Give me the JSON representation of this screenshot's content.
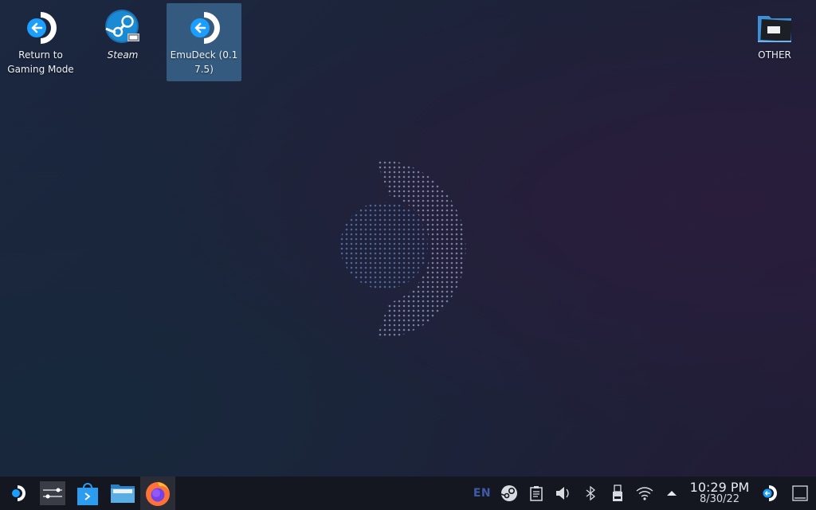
{
  "desktop": {
    "icons": [
      {
        "label": "Return to Gaming Mode",
        "icon": "return-to-gaming-mode-icon",
        "selected": false
      },
      {
        "label": "Steam",
        "icon": "steam-icon",
        "selected": false
      },
      {
        "label": "EmuDeck (0.17.5)",
        "icon": "emudeck-icon",
        "selected": true
      },
      {
        "label": "OTHER",
        "icon": "folder-icon",
        "selected": false
      }
    ],
    "wallpaper": "steam-deck-logo-dotted"
  },
  "taskbar": {
    "launchers": [
      {
        "name": "application-launcher",
        "icon": "steamdeck-logo-icon"
      },
      {
        "name": "system-settings",
        "icon": "sliders-icon"
      },
      {
        "name": "discover",
        "icon": "shopping-bag-icon"
      },
      {
        "name": "dolphin-file-manager",
        "icon": "folder-icon"
      },
      {
        "name": "firefox",
        "icon": "firefox-icon",
        "active": true
      }
    ],
    "tray": {
      "keyboard_layout": "EN",
      "items": [
        "steam-icon",
        "clipboard-icon",
        "volume-icon",
        "bluetooth-icon",
        "usb-storage-icon",
        "wifi-icon",
        "expand-arrow-icon"
      ],
      "time": "10:29 PM",
      "date": "8/30/22"
    }
  },
  "colors": {
    "accent": "#1a9fff",
    "selection": "#3d6e96",
    "taskbar": "#14171f"
  }
}
